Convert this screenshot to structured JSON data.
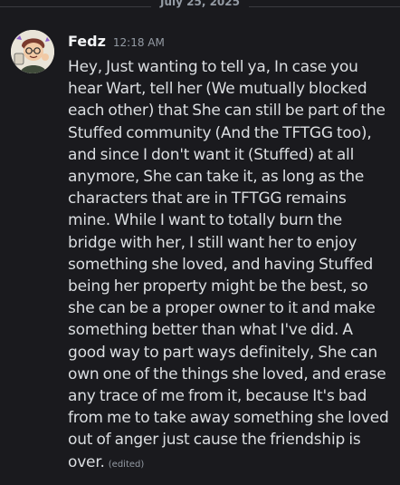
{
  "date_divider": {
    "label": "July 25, 2025"
  },
  "message": {
    "author": "Fedz",
    "timestamp": "12:18 AM",
    "content": "Hey, Just wanting to tell ya, In case you hear Wart, tell her (We mutually blocked each other) that She can still be part of the Stuffed community (And the TFTGG too), and since I don't want it (Stuffed) at all anymore, She can take it, as long as the characters that are in TFTGG remains mine. While I want to totally burn the bridge with her, I still want her to enjoy something she loved, and having Stuffed being her property might be the best, so she can be a proper owner to it and make something better than what I've did. A good way to part ways definitely, She can own one of the things she loved, and erase any trace of me from it, because It's bad from me to take away something she loved out of anger just cause the friendship is over.",
    "edited_label": "(edited)",
    "avatar_icon": "cartoon-character-avatar"
  },
  "colors": {
    "background": "#1a1a1e",
    "author": "#f2f3f5",
    "text": "#dbdee1",
    "muted": "#949ba4"
  }
}
